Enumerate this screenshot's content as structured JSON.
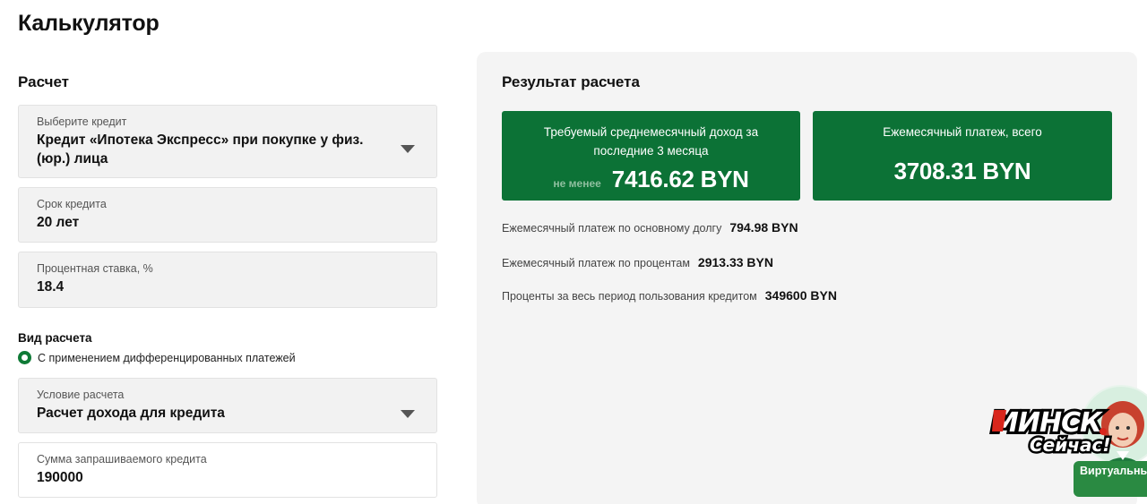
{
  "page": {
    "title": "Калькулятор"
  },
  "form": {
    "section_title": "Расчет",
    "credit": {
      "label": "Выберите кредит",
      "value": "Кредит «Ипотека Экспресс» при покупке у физ. (юр.) лица"
    },
    "term": {
      "label": "Срок кредита",
      "value": "20 лет"
    },
    "rate": {
      "label": "Процентная ставка, %",
      "value": "18.4"
    },
    "calc_type": {
      "label": "Вид расчета",
      "option": "С применением дифференцированных платежей"
    },
    "condition": {
      "label": "Условие расчета",
      "value": "Расчет дохода для кредита"
    },
    "amount": {
      "label": "Сумма запрашиваемого кредита",
      "value": "190000"
    }
  },
  "result": {
    "title": "Результат расчета",
    "card_income": {
      "title": "Требуемый среднемесячный доход за последние 3 месяца",
      "prefix": "не менее",
      "value": "7416.62 BYN"
    },
    "card_payment": {
      "title": "Ежемесячный платеж, всего",
      "value": "3708.31 BYN"
    },
    "details": [
      {
        "label": "Ежемесячный платеж по основному долгу",
        "value": "794.98 BYN"
      },
      {
        "label": "Ежемесячный платеж по процентам",
        "value": "2913.33 BYN"
      },
      {
        "label": "Проценты за весь период пользования кредитом",
        "value": "349600 BYN"
      }
    ]
  },
  "overlay": {
    "watermark_line1": "Минск",
    "watermark_line2": "Сейчас!",
    "assistant_label": "Виртуальный консультант"
  },
  "colors": {
    "accent_green": "#0c7236",
    "panel_bg": "#f4f4f4",
    "field_bg": "#f2f2f2"
  }
}
